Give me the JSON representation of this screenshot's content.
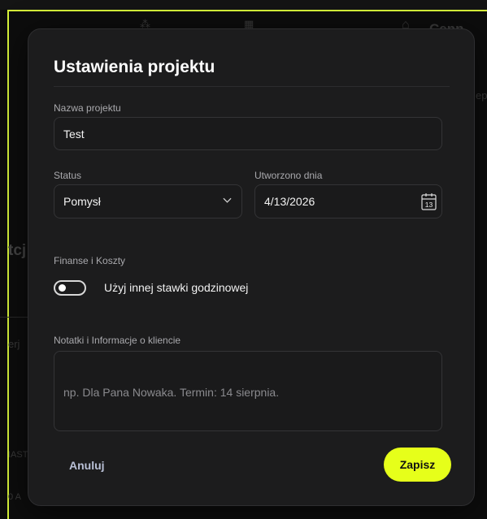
{
  "modal": {
    "title": "Ustawienia projektu",
    "name_label": "Nazwa projektu",
    "name_value": "Test",
    "status_label": "Status",
    "status_value": "Pomysł",
    "created_label": "Utworzono dnia",
    "created_value": "4/13/2026",
    "calendar_day": "13",
    "finance_label": "Finanse i Koszty",
    "toggle_label": "Użyj innej stawki godzinowej",
    "toggle_on": false,
    "notes_label": "Notatki i Informacje o kliencie",
    "notes_placeholder": "np. Dla Pana Nowaka. Termin: 14 sierpnia.",
    "cancel_label": "Anuluj",
    "save_label": "Zapisz"
  },
  "colors": {
    "accent": "#e6ff1a",
    "frame_border": "#d6f33a",
    "modal_bg": "#1c1c1d"
  },
  "icons": [
    "chevron-down-icon",
    "calendar-icon"
  ]
}
